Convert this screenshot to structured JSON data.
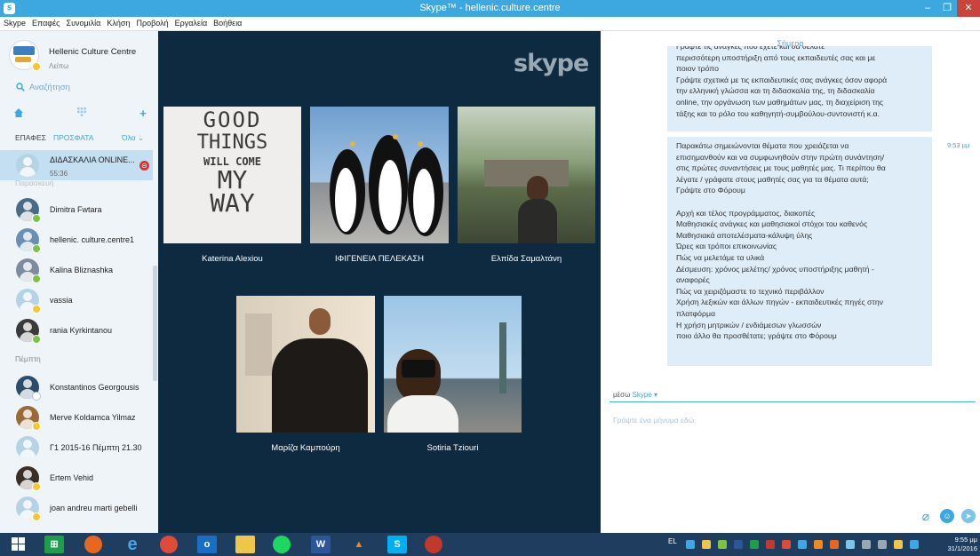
{
  "window": {
    "app_icon": "s",
    "title": "Skype™ - hellenic.culture.centre",
    "controls": [
      "–",
      "❐",
      "✕"
    ]
  },
  "menu": [
    "Skype",
    "Επαφές",
    "Συνομιλία",
    "Κλήση",
    "Προβολή",
    "Εργαλεία",
    "Βοήθεια"
  ],
  "sidebar": {
    "profile": {
      "name": "Hellenic Culture Centre",
      "status": "Λείπω"
    },
    "search_placeholder": "Αναζήτηση",
    "tabs": {
      "contacts": "ΕΠΑΦΕΣ",
      "recent": "ΠΡΟΣΦΑΤΑ",
      "filter": "Όλα"
    },
    "selected": {
      "name": "ΔΙΔΑΣΚΑΛΙΑ ONLINE...",
      "time": "55:36"
    },
    "day_label_1": "Παρασκευή",
    "day_label_2": "Πέμπτη",
    "contacts": [
      {
        "name": "Dimitra Fwtara",
        "presence": "online",
        "color": "#4a6b85"
      },
      {
        "name": "hellenic. culture.centre1",
        "presence": "online",
        "color": "#6a8fb3"
      },
      {
        "name": "Kalina Bliznashka",
        "presence": "online",
        "color": "#7f8ca0"
      },
      {
        "name": "vassia",
        "presence": "away",
        "color": "#b6d3e6"
      },
      {
        "name": "rania Kyrkintanou",
        "presence": "online",
        "color": "#3a3a3a"
      },
      {
        "name": "Konstantinos Georgousis",
        "presence": "offline",
        "color": "#2e4b6a"
      },
      {
        "name": "Merve Koldamca Yilmaz",
        "presence": "away",
        "color": "#9a6a3a"
      },
      {
        "name": "Γ1 2015-16 Πέμπτη 21.30",
        "presence": "none",
        "color": "#b6d3e6"
      },
      {
        "name": "Ertem Vehid",
        "presence": "away",
        "color": "#3b2e24"
      },
      {
        "name": "joan andreu marti gebelli",
        "presence": "away",
        "color": "#b6d3e6"
      }
    ]
  },
  "call": {
    "logo": "skype",
    "participants": [
      {
        "name": "Katerina Alexiou"
      },
      {
        "name": "ΙΦΙΓΕΝΕΙΑ ΠΕΛΕΚΑΣΗ"
      },
      {
        "name": "Ελπίδα Σαμαλτάνη"
      },
      {
        "name": "Μαρίζα Καμπούρη"
      },
      {
        "name": "Sotiria Tziouri"
      }
    ],
    "tile1_text": [
      "GOOD",
      "THINGS",
      "WILL COME",
      "MY",
      "WAY"
    ]
  },
  "chat": {
    "day": "Σήμερα",
    "message1": [
      "Γράψτε τις ανάγκες που έχετε και θα θέλατε",
      "περισσότερη υποστήριξη από τους εκπαιδευτές σας και με",
      "ποιον τρόπο",
      "Γράψτε σχετικά με τις εκπαιδευτικές σας ανάγκες όσον αφορά",
      "την ελληνική γλώσσα και τη διδασκαλία της, τη διδασκαλία",
      "online, την οργάνωση των μαθημάτων μας, τη διαχείριση της",
      "τάξης και το ρόλο του καθηγητή-συμβούλου-συντονιστή κ.α."
    ],
    "message2": [
      "Παρακάτω σημειώνονται θέματα που χρειάζεται να",
      "επισημανθούν και να συμφωνηθούν στην πρώτη συνάντηση/",
      "στις πρώτες συναντήσεις με τους μαθητές μας. Τι περίπου θα",
      "λέγατε / γράφατε στους μαθητές σας για τα θέματα αυτά;",
      "Γράψτε στο Φόρουμ",
      "",
      "Αρχή και τέλος προγράμματος, διακοπές",
      "Μαθησιακές ανάγκες και μαθησιακοί στόχοι του καθενός",
      "Μαθησιακά αποτελέσματα-κάλυψη ύλης",
      "Ώρες και τρόποι επικοινωνίας",
      "Πώς να μελετάμε τα υλικά",
      "Δέσμευση: χρόνος μελέτης/ χρόνος υποστήριξης μαθητή -",
      "αναφορές",
      "Πώς να χειριζόμαστε το τεχνικό περιβάλλον",
      "Χρήση λεξικών και άλλων πηγών - εκπαιδευτικές πηγές στην",
      "πλατφόρμα",
      "Η χρήση μητρικών / ενδιάμεσων γλωσσών",
      "ποιο άλλο θα προσθέτατε; γράψτε στο Φόρουμ"
    ],
    "timestamp": "9:53 μμ",
    "via": "μέσω",
    "via_link": "Skype ▾",
    "input_placeholder": "Γράψτε ένα μήνυμα εδώ"
  },
  "taskbar": {
    "lang": "EL",
    "clock_time": "9:55 μμ",
    "clock_date": "31/1/2016"
  }
}
